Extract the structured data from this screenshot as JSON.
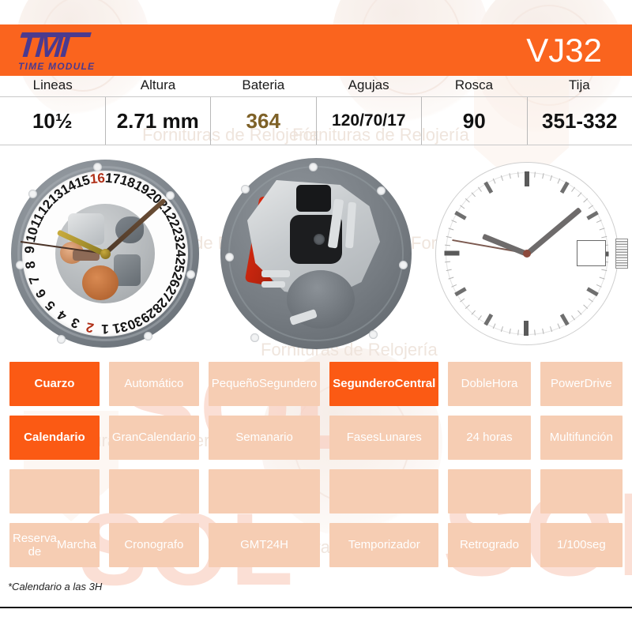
{
  "header": {
    "logo_main": "TMI",
    "logo_sub": "TIME MODULE",
    "model": "VJ32",
    "accent_color": "#fa641e"
  },
  "spec_table": {
    "headers": [
      "Lineas",
      "Altura",
      "Bateria",
      "Agujas",
      "Rosca",
      "Tija"
    ],
    "values": [
      "10½",
      "2.71 mm",
      "364",
      "120/70/17",
      "90",
      "351-332"
    ],
    "highlight_color": "#7e6127"
  },
  "images": {
    "front": {
      "name": "movement-front-date-wheel",
      "date_numbers": [
        "1",
        "2",
        "3",
        "4",
        "5",
        "6",
        "7",
        "8",
        "9",
        "10",
        "11",
        "12",
        "13",
        "14",
        "15",
        "16",
        "17",
        "18",
        "19",
        "20",
        "21",
        "22",
        "23",
        "24",
        "25",
        "26",
        "27",
        "28",
        "29",
        "30",
        "31"
      ],
      "red_dates": [
        "2",
        "16"
      ]
    },
    "back": {
      "name": "movement-back-circuit"
    },
    "dial": {
      "name": "dial-diagram",
      "date_window_position": "3H"
    }
  },
  "features": {
    "rows": [
      [
        {
          "label": "Cuarzo",
          "active": true
        },
        {
          "label": "Automático",
          "active": false
        },
        {
          "label": "Pequeño\nSegundero",
          "active": false
        },
        {
          "label": "Segundero\nCentral",
          "active": true
        },
        {
          "label": "Doble\nHora",
          "active": false
        },
        {
          "label": "Power\nDrive",
          "active": false
        }
      ],
      [
        {
          "label": "Calendario",
          "active": true
        },
        {
          "label": "Gran\nCalendario",
          "active": false
        },
        {
          "label": "Semanario",
          "active": false
        },
        {
          "label": "Fases\nLunares",
          "active": false
        },
        {
          "label": "24 horas",
          "active": false
        },
        {
          "label": "Multifunción",
          "active": false
        }
      ],
      [
        {
          "label": "",
          "active": false
        },
        {
          "label": "",
          "active": false
        },
        {
          "label": "",
          "active": false
        },
        {
          "label": "",
          "active": false
        },
        {
          "label": "",
          "active": false
        },
        {
          "label": "",
          "active": false
        }
      ],
      [
        {
          "label": "Reserva de\nMarcha",
          "active": false
        },
        {
          "label": "Cronografo",
          "active": false
        },
        {
          "label": "GMT\n24H",
          "active": false
        },
        {
          "label": "Temporizador",
          "active": false
        },
        {
          "label": "Retrogrado",
          "active": false
        },
        {
          "label": "1/100\nseg",
          "active": false
        }
      ]
    ],
    "active_color": "#fb5a14",
    "inactive_color": "#f6cdb3"
  },
  "footnote": "*Calendario a las 3H",
  "watermark": {
    "brand": "SOL",
    "tagline": "Fornituras de Relojería",
    "color": "#f9c6b4"
  }
}
